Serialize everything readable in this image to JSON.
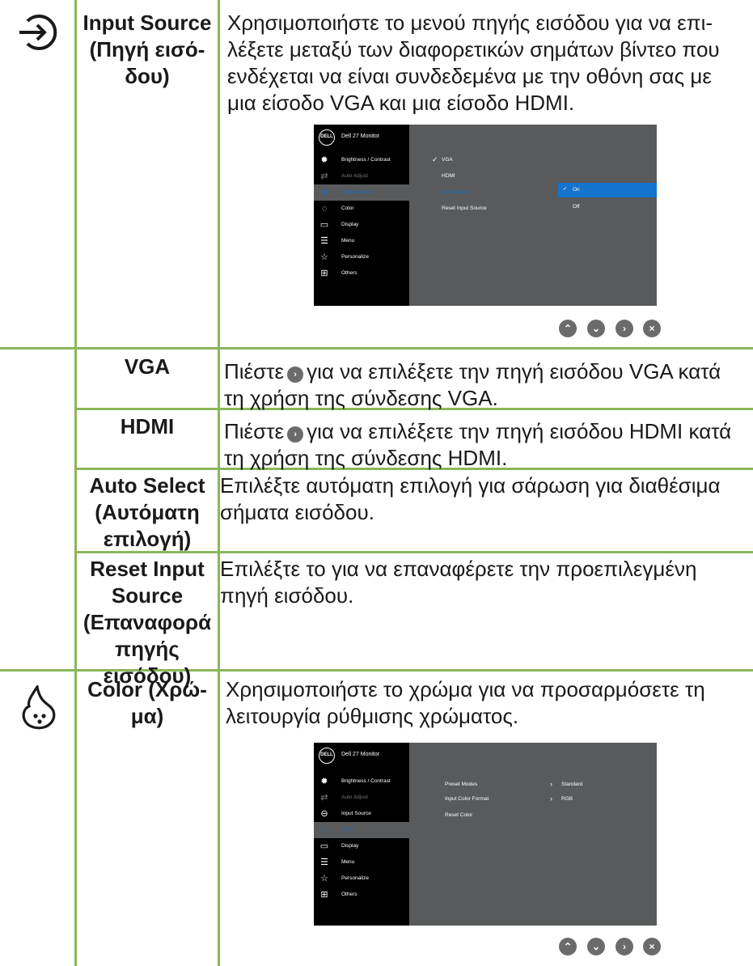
{
  "rows": {
    "input_source": {
      "title": "Input Source\n(Πηγή εισό-\nδου)",
      "desc": "Χρησιμοποιήστε το μενού πηγής εισόδου για να επι-\nλέξετε μεταξύ των διαφορετικών σημάτων βίντεο που\nενδέχεται να είναι συνδεδεμένα με την οθόνη σας με\nμια είσοδο VGA και μια είσοδο HDMI."
    },
    "vga": {
      "title": "VGA",
      "desc_pre": "Πιέστε",
      "desc_post": "για να επιλέξετε την πηγή εισόδου VGA κατά\nτη χρήση της σύνδεσης VGA."
    },
    "hdmi": {
      "title": "HDMI",
      "desc_pre": "Πιέστε",
      "desc_post": "για να επιλέξετε την πηγή εισόδου HDMI κατά\nτη χρήση της σύνδεσης HDMI."
    },
    "auto_select": {
      "title": "Auto Select\n(Αυτόματη\nεπιλογή)",
      "desc": "Επιλέξτε αυτόματη επιλογή για σάρωση για διαθέσιμα\nσήματα εισόδου."
    },
    "reset_input": {
      "title": "Reset Input\nSource\n(Επαναφορά\nπηγής\nεισόδου)",
      "desc": "Επιλέξτε το για να επαναφέρετε την προεπιλεγμένη\nπηγή εισόδου."
    },
    "color": {
      "title": "Color (Χρώ-\nμα)",
      "desc": "Χρησιμοποιήστε το χρώμα για να προσαρμόσετε τη\nλειτουργία ρύθμισης χρώματος."
    }
  },
  "osd": {
    "logo": "DELL",
    "title": "Dell 27 Monitor",
    "menu": [
      "Brightness / Contrast",
      "Auto Adjust",
      "Input Source",
      "Color",
      "Display",
      "Menu",
      "Personalize",
      "Others"
    ],
    "input_options": [
      "VGA",
      "HDMI",
      "Auto Select",
      "Reset Input Source"
    ],
    "auto_select_values": [
      "On",
      "Off"
    ],
    "color_options": [
      "Preset Modes",
      "Input Color Format",
      "Reset Color"
    ],
    "color_values": [
      "Standard",
      "RGB"
    ]
  },
  "colors": {
    "table_border": "#8ab75a",
    "osd_highlight": "#1474cc",
    "osd_panel": "#585a5c"
  }
}
